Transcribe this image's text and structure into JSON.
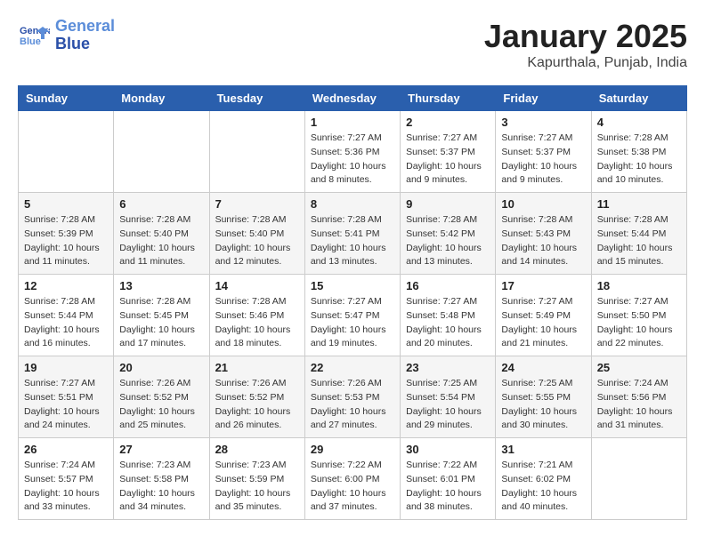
{
  "header": {
    "logo_line1": "General",
    "logo_line2": "Blue",
    "title": "January 2025",
    "subtitle": "Kapurthala, Punjab, India"
  },
  "days_of_week": [
    "Sunday",
    "Monday",
    "Tuesday",
    "Wednesday",
    "Thursday",
    "Friday",
    "Saturday"
  ],
  "weeks": [
    [
      {
        "day": "",
        "info": ""
      },
      {
        "day": "",
        "info": ""
      },
      {
        "day": "",
        "info": ""
      },
      {
        "day": "1",
        "info": "Sunrise: 7:27 AM\nSunset: 5:36 PM\nDaylight: 10 hours\nand 8 minutes."
      },
      {
        "day": "2",
        "info": "Sunrise: 7:27 AM\nSunset: 5:37 PM\nDaylight: 10 hours\nand 9 minutes."
      },
      {
        "day": "3",
        "info": "Sunrise: 7:27 AM\nSunset: 5:37 PM\nDaylight: 10 hours\nand 9 minutes."
      },
      {
        "day": "4",
        "info": "Sunrise: 7:28 AM\nSunset: 5:38 PM\nDaylight: 10 hours\nand 10 minutes."
      }
    ],
    [
      {
        "day": "5",
        "info": "Sunrise: 7:28 AM\nSunset: 5:39 PM\nDaylight: 10 hours\nand 11 minutes."
      },
      {
        "day": "6",
        "info": "Sunrise: 7:28 AM\nSunset: 5:40 PM\nDaylight: 10 hours\nand 11 minutes."
      },
      {
        "day": "7",
        "info": "Sunrise: 7:28 AM\nSunset: 5:40 PM\nDaylight: 10 hours\nand 12 minutes."
      },
      {
        "day": "8",
        "info": "Sunrise: 7:28 AM\nSunset: 5:41 PM\nDaylight: 10 hours\nand 13 minutes."
      },
      {
        "day": "9",
        "info": "Sunrise: 7:28 AM\nSunset: 5:42 PM\nDaylight: 10 hours\nand 13 minutes."
      },
      {
        "day": "10",
        "info": "Sunrise: 7:28 AM\nSunset: 5:43 PM\nDaylight: 10 hours\nand 14 minutes."
      },
      {
        "day": "11",
        "info": "Sunrise: 7:28 AM\nSunset: 5:44 PM\nDaylight: 10 hours\nand 15 minutes."
      }
    ],
    [
      {
        "day": "12",
        "info": "Sunrise: 7:28 AM\nSunset: 5:44 PM\nDaylight: 10 hours\nand 16 minutes."
      },
      {
        "day": "13",
        "info": "Sunrise: 7:28 AM\nSunset: 5:45 PM\nDaylight: 10 hours\nand 17 minutes."
      },
      {
        "day": "14",
        "info": "Sunrise: 7:28 AM\nSunset: 5:46 PM\nDaylight: 10 hours\nand 18 minutes."
      },
      {
        "day": "15",
        "info": "Sunrise: 7:27 AM\nSunset: 5:47 PM\nDaylight: 10 hours\nand 19 minutes."
      },
      {
        "day": "16",
        "info": "Sunrise: 7:27 AM\nSunset: 5:48 PM\nDaylight: 10 hours\nand 20 minutes."
      },
      {
        "day": "17",
        "info": "Sunrise: 7:27 AM\nSunset: 5:49 PM\nDaylight: 10 hours\nand 21 minutes."
      },
      {
        "day": "18",
        "info": "Sunrise: 7:27 AM\nSunset: 5:50 PM\nDaylight: 10 hours\nand 22 minutes."
      }
    ],
    [
      {
        "day": "19",
        "info": "Sunrise: 7:27 AM\nSunset: 5:51 PM\nDaylight: 10 hours\nand 24 minutes."
      },
      {
        "day": "20",
        "info": "Sunrise: 7:26 AM\nSunset: 5:52 PM\nDaylight: 10 hours\nand 25 minutes."
      },
      {
        "day": "21",
        "info": "Sunrise: 7:26 AM\nSunset: 5:52 PM\nDaylight: 10 hours\nand 26 minutes."
      },
      {
        "day": "22",
        "info": "Sunrise: 7:26 AM\nSunset: 5:53 PM\nDaylight: 10 hours\nand 27 minutes."
      },
      {
        "day": "23",
        "info": "Sunrise: 7:25 AM\nSunset: 5:54 PM\nDaylight: 10 hours\nand 29 minutes."
      },
      {
        "day": "24",
        "info": "Sunrise: 7:25 AM\nSunset: 5:55 PM\nDaylight: 10 hours\nand 30 minutes."
      },
      {
        "day": "25",
        "info": "Sunrise: 7:24 AM\nSunset: 5:56 PM\nDaylight: 10 hours\nand 31 minutes."
      }
    ],
    [
      {
        "day": "26",
        "info": "Sunrise: 7:24 AM\nSunset: 5:57 PM\nDaylight: 10 hours\nand 33 minutes."
      },
      {
        "day": "27",
        "info": "Sunrise: 7:23 AM\nSunset: 5:58 PM\nDaylight: 10 hours\nand 34 minutes."
      },
      {
        "day": "28",
        "info": "Sunrise: 7:23 AM\nSunset: 5:59 PM\nDaylight: 10 hours\nand 35 minutes."
      },
      {
        "day": "29",
        "info": "Sunrise: 7:22 AM\nSunset: 6:00 PM\nDaylight: 10 hours\nand 37 minutes."
      },
      {
        "day": "30",
        "info": "Sunrise: 7:22 AM\nSunset: 6:01 PM\nDaylight: 10 hours\nand 38 minutes."
      },
      {
        "day": "31",
        "info": "Sunrise: 7:21 AM\nSunset: 6:02 PM\nDaylight: 10 hours\nand 40 minutes."
      },
      {
        "day": "",
        "info": ""
      }
    ]
  ]
}
